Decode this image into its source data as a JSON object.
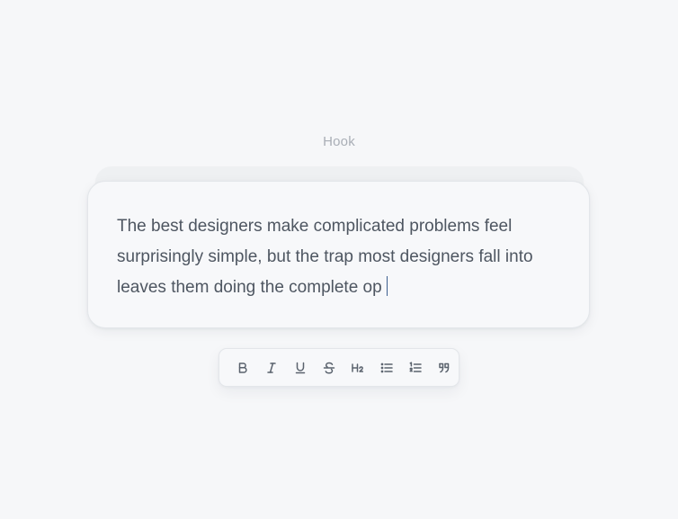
{
  "editor": {
    "label": "Hook",
    "content": "The best designers make complicated problems feel surprisingly simple, but the trap most designers fall into leaves them doing the complete op"
  },
  "toolbar": {
    "buttons": [
      {
        "name": "bold-button",
        "icon": "bold-icon"
      },
      {
        "name": "italic-button",
        "icon": "italic-icon"
      },
      {
        "name": "underline-button",
        "icon": "underline-icon"
      },
      {
        "name": "strikethrough-button",
        "icon": "strikethrough-icon"
      },
      {
        "name": "heading-2-button",
        "icon": "heading-2-icon"
      },
      {
        "name": "bullet-list-button",
        "icon": "bullet-list-icon"
      },
      {
        "name": "numbered-list-button",
        "icon": "numbered-list-icon"
      },
      {
        "name": "quote-button",
        "icon": "quote-icon"
      }
    ]
  },
  "colors": {
    "background": "#f6f7f9",
    "text": "#4e5661",
    "label": "#a9aeb6",
    "caret": "#3d5f8f"
  }
}
